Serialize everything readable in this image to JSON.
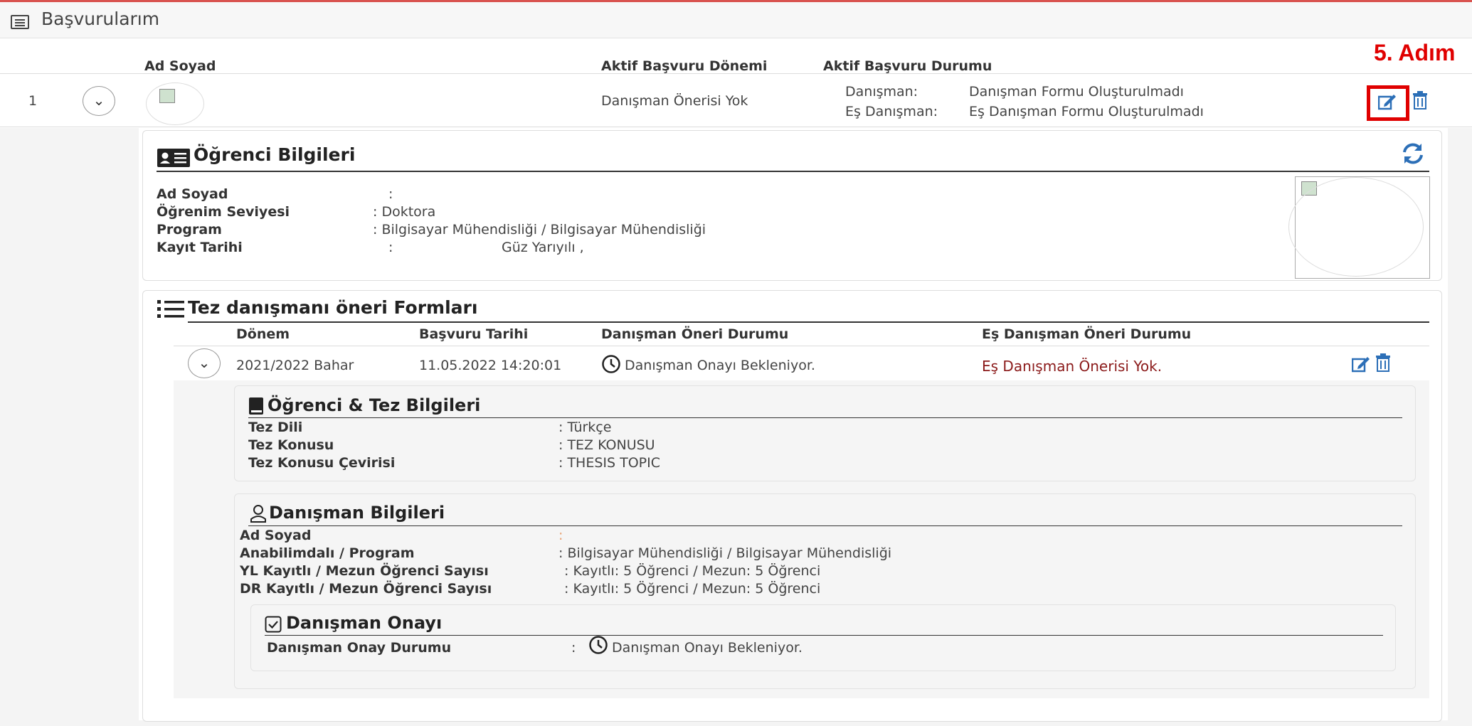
{
  "page": {
    "title": "Başvurularım"
  },
  "annotation": {
    "step_label": "5. Adım",
    "color": "#e00000"
  },
  "table": {
    "headers": {
      "name": "Ad Soyad",
      "period": "Aktif Başvuru Dönemi",
      "status": "Aktif Başvuru Durumu"
    },
    "row": {
      "index": "1",
      "period_value": "Danışman Önerisi Yok",
      "advisor_label": "Danışman:",
      "advisor_status": "Danışman Formu Oluşturulmadı",
      "co_advisor_label": "Eş Danışman:",
      "co_advisor_status": "Eş Danışman Formu Oluşturulmadı"
    }
  },
  "student": {
    "title": "Öğrenci Bilgileri",
    "fields": [
      {
        "label": "Ad Soyad",
        "value": ":"
      },
      {
        "label": "Öğrenim Seviyesi",
        "value": ": Doktora"
      },
      {
        "label": "Program",
        "value": ": Bilgisayar Mühendisliği / Bilgisayar Mühendisliği"
      },
      {
        "label": "Kayıt Tarihi",
        "value": ":",
        "extra": "Güz Yarıyılı ,"
      }
    ]
  },
  "forms": {
    "title": "Tez danışmanı öneri Formları",
    "headers": {
      "period": "Dönem",
      "date": "Başvuru Tarihi",
      "advisor_status": "Danışman Öneri Durumu",
      "co_advisor_status": "Eş Danışman Öneri Durumu"
    },
    "row": {
      "period": "2021/2022 Bahar",
      "date": "11.05.2022 14:20:01",
      "advisor_status": "Danışman Onayı Bekleniyor.",
      "co_advisor_status": "Eş Danışman Önerisi Yok."
    }
  },
  "thesis": {
    "title": "Öğrenci & Tez Bilgileri",
    "fields": [
      {
        "label": "Tez Dili",
        "value": ": Türkçe"
      },
      {
        "label": "Tez Konusu",
        "value": ": TEZ KONUSU"
      },
      {
        "label": "Tez Konusu Çevirisi",
        "value": ": THESIS TOPIC"
      }
    ]
  },
  "advisor": {
    "title": "Danışman Bilgileri",
    "fields": [
      {
        "label": "Ad Soyad",
        "value": ":"
      },
      {
        "label": "Anabilimdalı / Program",
        "value": ": Bilgisayar Mühendisliği / Bilgisayar Mühendisliği"
      },
      {
        "label": "YL Kayıtlı / Mezun Öğrenci Sayısı",
        "value": ": Kayıtlı: 5 Öğrenci / Mezun: 5 Öğrenci"
      },
      {
        "label": "DR Kayıtlı / Mezun Öğrenci Sayısı",
        "value": ": Kayıtlı: 5 Öğrenci / Mezun: 5 Öğrenci"
      }
    ]
  },
  "approval": {
    "title": "Danışman Onayı",
    "label": "Danışman Onay Durumu",
    "colon": ":",
    "value": "Danışman Onayı Bekleniyor."
  },
  "colors": {
    "link_blue": "#2c6fb7",
    "dark_red": "#8b1a1a",
    "annotation_red": "#e00000"
  }
}
